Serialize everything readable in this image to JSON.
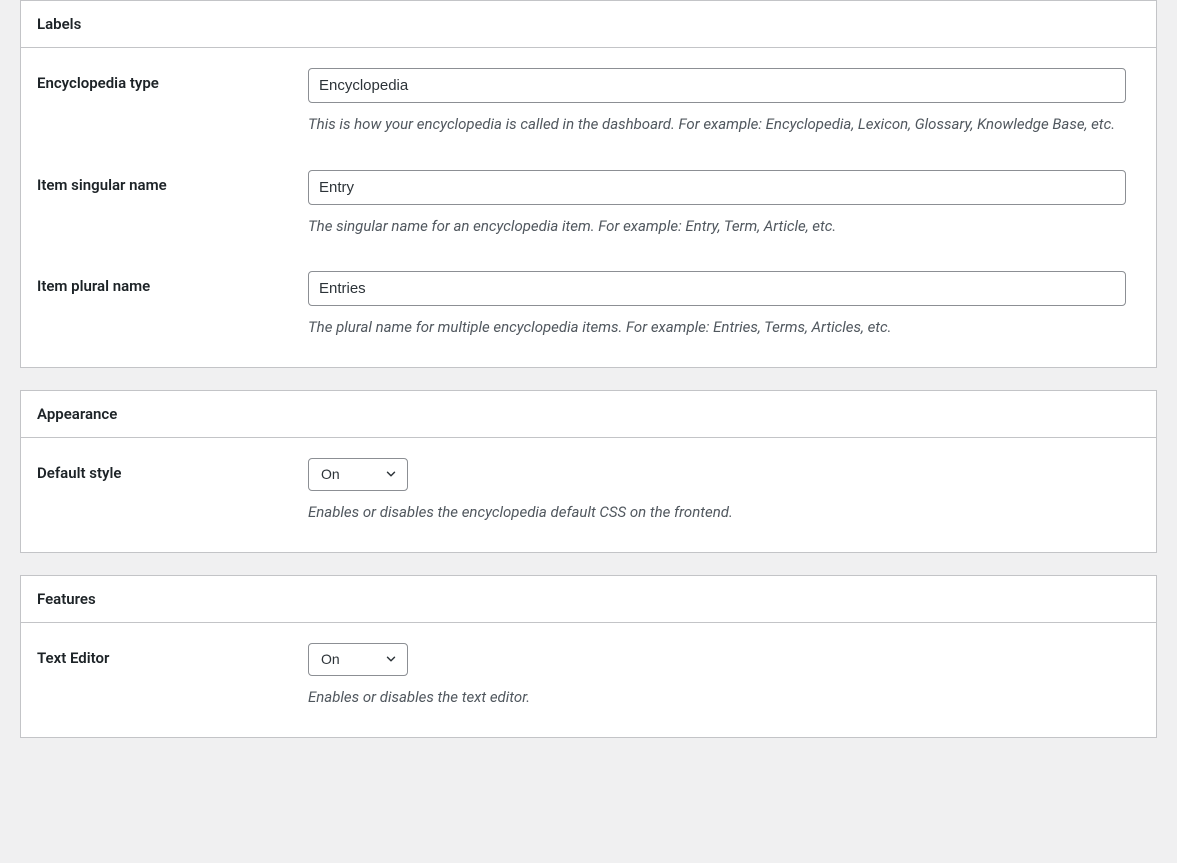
{
  "sections": {
    "labels": {
      "title": "Labels",
      "encyclopedia_type": {
        "label": "Encyclopedia type",
        "value": "Encyclopedia",
        "description": "This is how your encyclopedia is called in the dashboard. For example: Encyclopedia, Lexicon, Glossary, Knowledge Base, etc."
      },
      "item_singular": {
        "label": "Item singular name",
        "value": "Entry",
        "description": "The singular name for an encyclopedia item. For example: Entry, Term, Article, etc."
      },
      "item_plural": {
        "label": "Item plural name",
        "value": "Entries",
        "description": "The plural name for multiple encyclopedia items. For example: Entries, Terms, Articles, etc."
      }
    },
    "appearance": {
      "title": "Appearance",
      "default_style": {
        "label": "Default style",
        "value": "On",
        "description": "Enables or disables the encyclopedia default CSS on the frontend."
      }
    },
    "features": {
      "title": "Features",
      "text_editor": {
        "label": "Text Editor",
        "value": "On",
        "description": "Enables or disables the text editor."
      }
    }
  }
}
